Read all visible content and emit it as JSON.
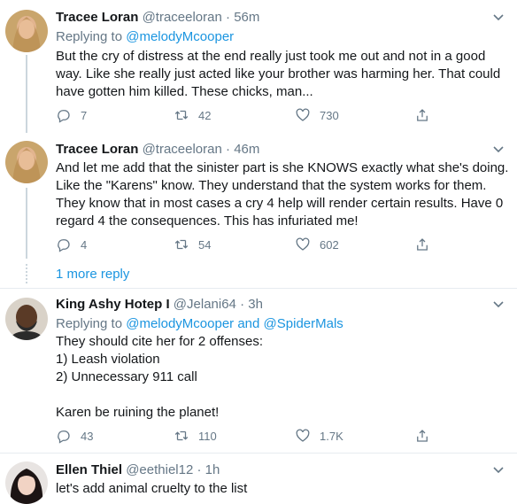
{
  "tweets": [
    {
      "name": "Tracee Loran",
      "handle": "@traceeloran",
      "time": "56m",
      "replying_prefix": "Replying to",
      "replying_to": "@melodyMcooper",
      "lines": [
        "But the cry of distress at the end really just took me out and not in a good",
        "way. Like she really just acted like your brother was harming her. That could",
        "have gotten him killed. These chicks, man..."
      ],
      "replies": "7",
      "retweets": "42",
      "likes": "730"
    },
    {
      "name": "Tracee Loran",
      "handle": "@traceeloran",
      "time": "46m",
      "lines": [
        "And let me add that the sinister part is she KNOWS exactly what she's doing.",
        "Like the \"Karens\" know. They understand that the system works for them.",
        "They know that in most cases a cry 4 help will render certain results. Have 0",
        "regard 4 the consequences. This has infuriated me!"
      ],
      "replies": "4",
      "retweets": "54",
      "likes": "602"
    },
    {
      "name": "King Ashy Hotep I",
      "handle": "@Jelani64",
      "time": "3h",
      "replying_prefix": "Replying to",
      "replying_to": "@melodyMcooper",
      "replying_and": "and",
      "replying_to_2": "@SpiderMals",
      "lines": [
        "They should cite her for 2 offenses:",
        "1) Leash violation",
        "2) Unnecessary 911 call",
        "",
        "Karen be ruining the planet!"
      ],
      "replies": "43",
      "retweets": "110",
      "likes": "1.7K"
    },
    {
      "name": "Ellen Thiel",
      "handle": "@eethiel12",
      "time": "1h",
      "lines": [
        "let's add animal cruelty to the list"
      ]
    }
  ],
  "more_replies": "1 more reply",
  "separator_dot": "·",
  "colors": {
    "link": "#1b95e0",
    "secondary_text": "#657786",
    "divider": "#e6ecf0"
  },
  "icons": [
    "reply-icon",
    "retweet-icon",
    "like-icon",
    "share-icon",
    "chevron-down-icon"
  ]
}
